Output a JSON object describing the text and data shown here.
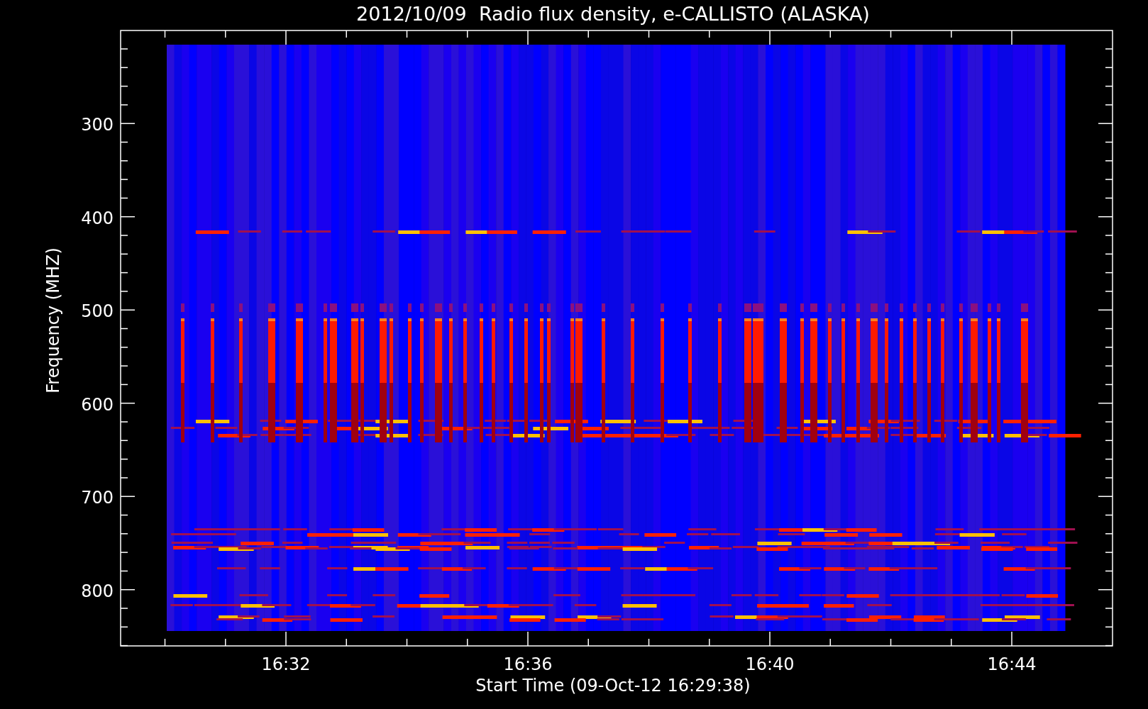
{
  "title": "2012/10/09  Radio flux density, e-CALLISTO (ALASKA)",
  "y_axis": {
    "label": "Frequency (MHZ)",
    "ticks": [
      "300",
      "400",
      "500",
      "600",
      "700",
      "800"
    ]
  },
  "x_axis": {
    "label": "Start Time (09-Oct-12 16:29:38)",
    "ticks": [
      "16:32",
      "16:36",
      "16:40",
      "16:44"
    ]
  }
}
